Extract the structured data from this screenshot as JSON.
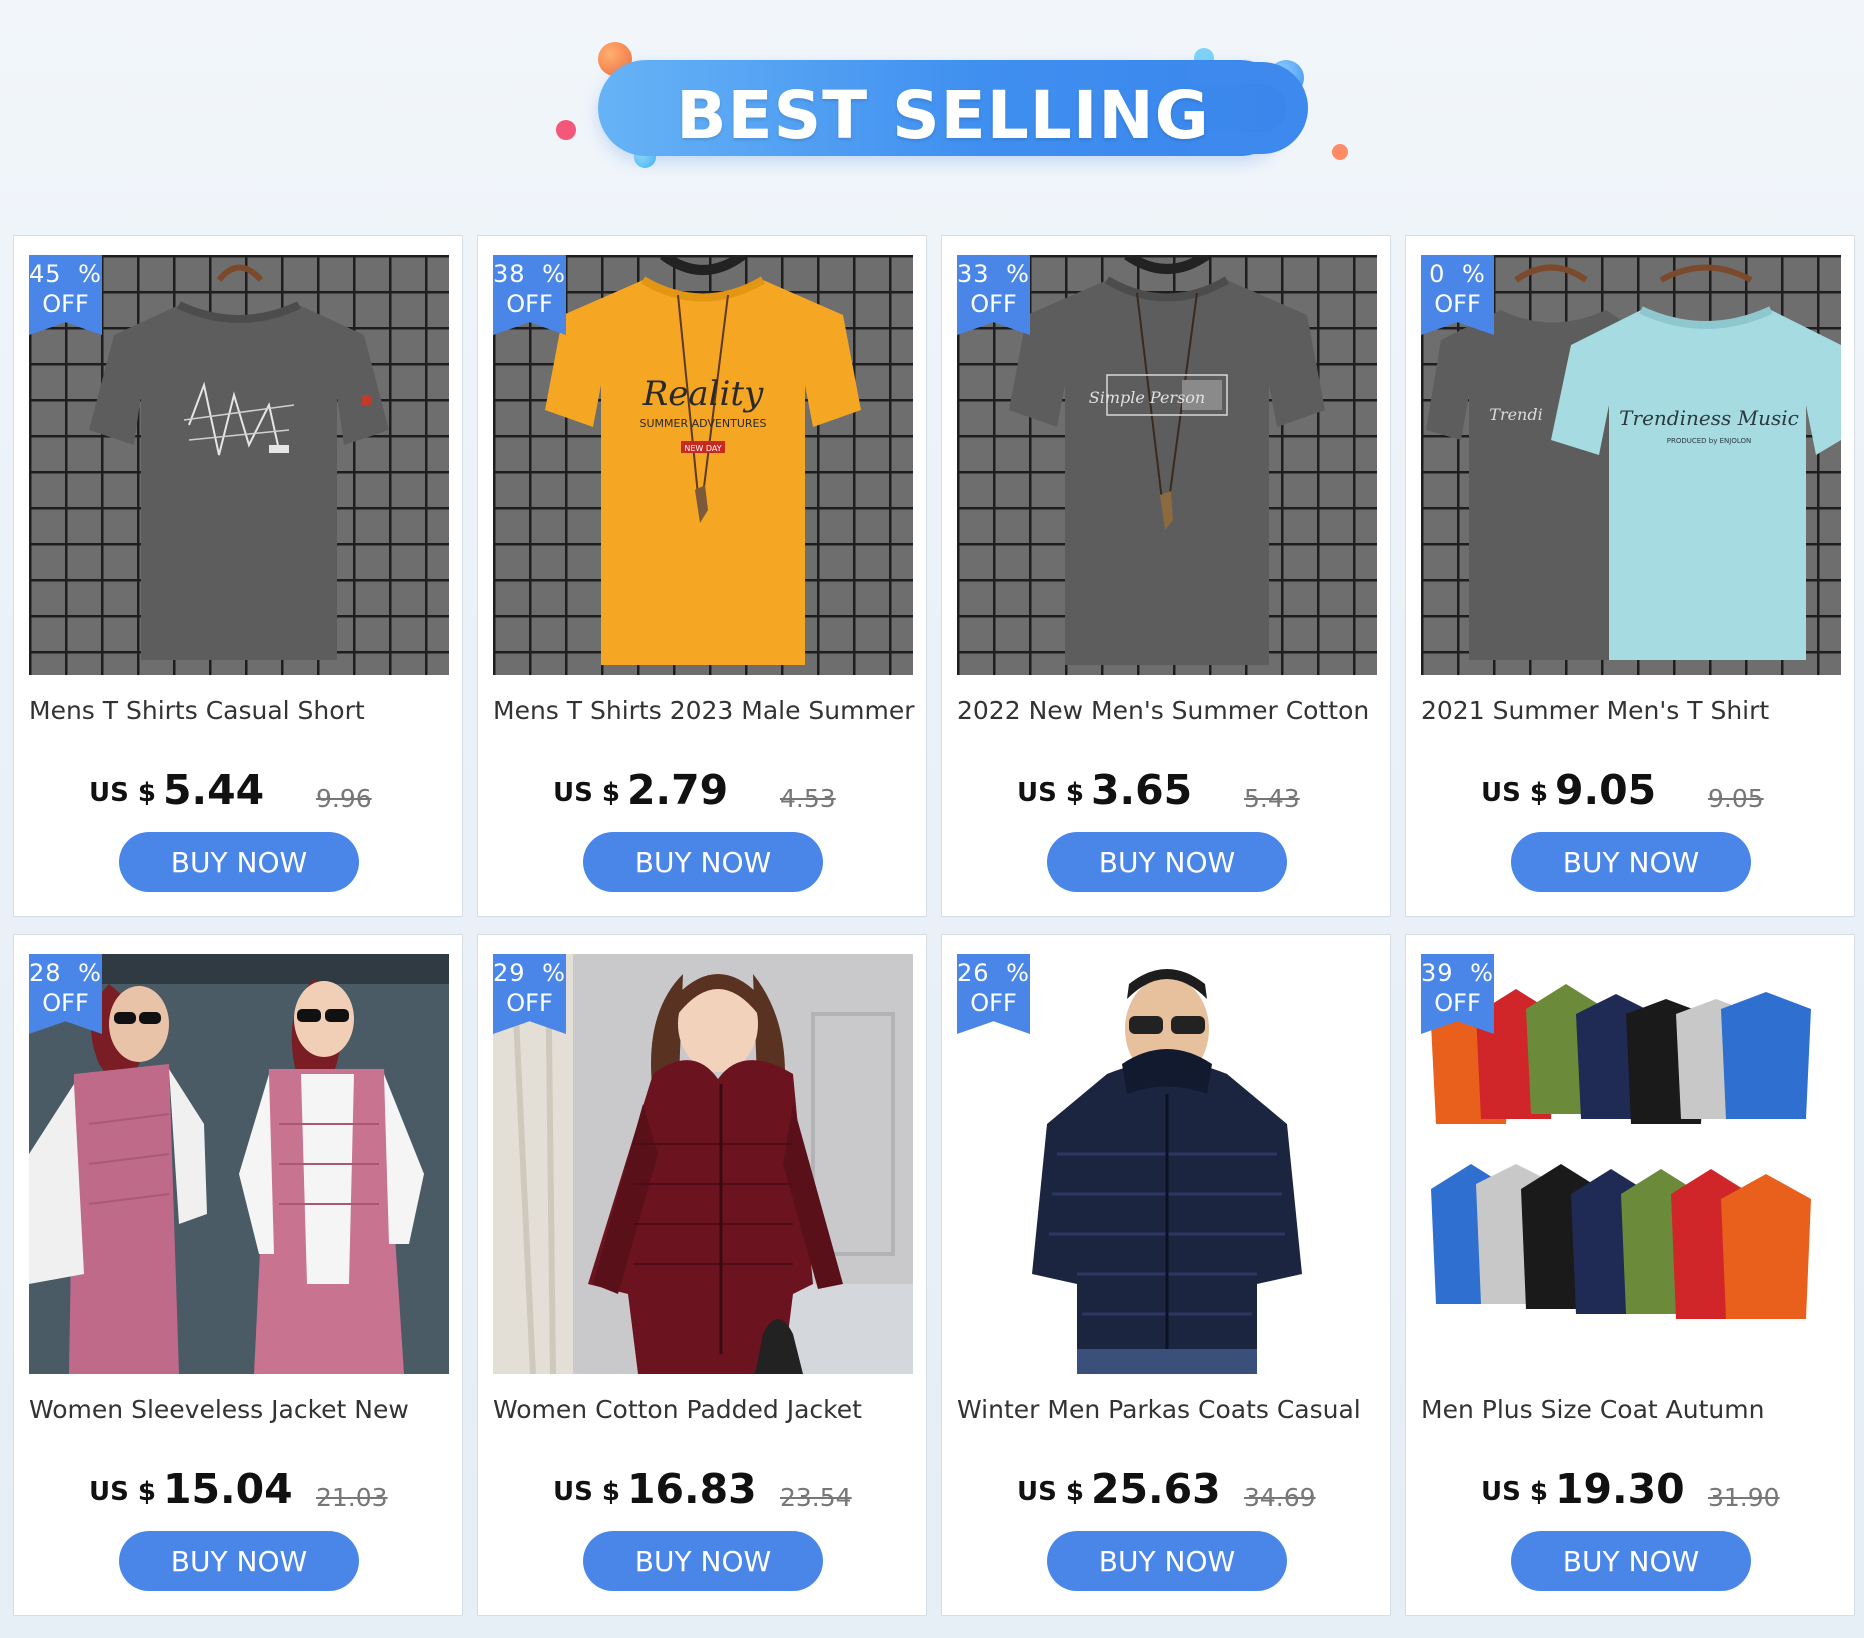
{
  "banner": {
    "title": "BEST SELLING"
  },
  "labels": {
    "currency": "US $",
    "buy": "BUY NOW",
    "off": "OFF"
  },
  "products": [
    {
      "discount": "45 %",
      "title": "Mens T Shirts Casual Short",
      "price": "5.44",
      "original_price": "9.96",
      "image": "gray-tshirt-graphic"
    },
    {
      "discount": "38 %",
      "title": "Mens T Shirts 2023 Male Summer",
      "price": "2.79",
      "original_price": "4.53",
      "image": "yellow-tshirt-reality"
    },
    {
      "discount": "33 %",
      "title": "2022 New Men's Summer Cotton",
      "price": "3.65",
      "original_price": "5.43",
      "image": "gray-tshirt-necklace"
    },
    {
      "discount": "0 %",
      "title": "2021 Summer Men's T Shirt",
      "price": "9.05",
      "original_price": "9.05",
      "image": "gray-and-lightblue-tshirts"
    },
    {
      "discount": "28 %",
      "title": "Women Sleeveless Jacket New",
      "price": "15.04",
      "original_price": "21.03",
      "image": "pink-hooded-vests"
    },
    {
      "discount": "29 %",
      "title": "Women Cotton Padded Jacket",
      "price": "16.83",
      "original_price": "23.54",
      "image": "burgundy-padded-jacket"
    },
    {
      "discount": "26 %",
      "title": "Winter Men Parkas Coats Casual",
      "price": "25.63",
      "original_price": "34.69",
      "image": "navy-hooded-parka"
    },
    {
      "discount": "39 %",
      "title": "Men Plus Size Coat Autumn",
      "price": "19.30",
      "original_price": "31.90",
      "image": "colorful-down-jackets"
    }
  ],
  "colors": {
    "accent": "#4a86e8",
    "banner": "#3f8ff0"
  }
}
